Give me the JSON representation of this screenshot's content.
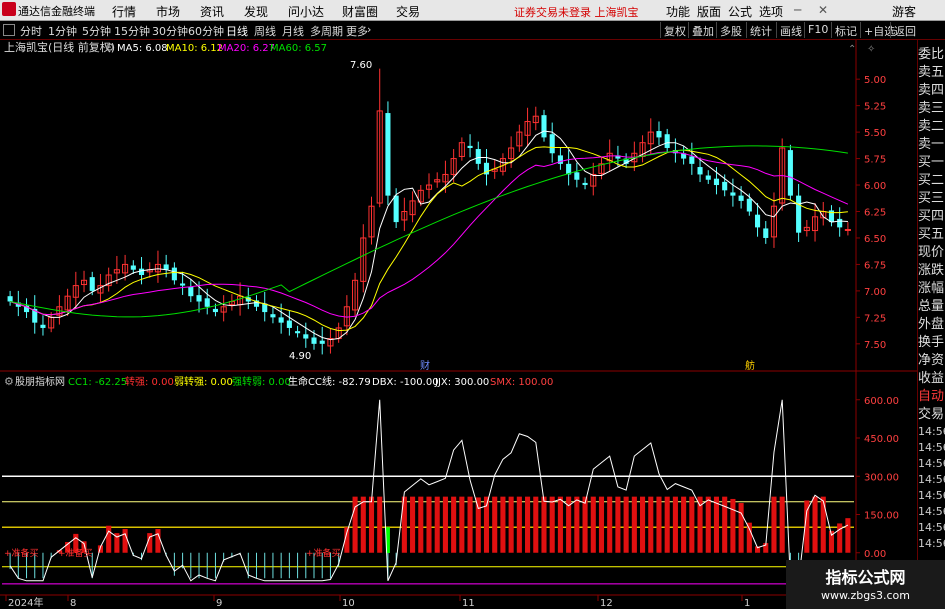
{
  "menubar": {
    "app": "通达信金融终端",
    "items": [
      "行情",
      "市场",
      "资讯",
      "发现",
      "问小达",
      "财富圈",
      "交易"
    ],
    "warning": "证券交易未登录  上海凯宝",
    "right": [
      "功能",
      "版面",
      "公式",
      "选项"
    ],
    "guest": "游客"
  },
  "toolbar": {
    "periods": [
      "分时",
      "1分钟",
      "5分钟",
      "15分钟",
      "30分钟",
      "60分钟",
      "日线",
      "周线",
      "月线",
      "多周期",
      "更多"
    ],
    "selected": "日线",
    "right": [
      "复权",
      "叠加",
      "多股",
      "统计",
      "画线",
      "F10",
      "标记",
      "+自选",
      "返回"
    ]
  },
  "main": {
    "name": "上海凯宝(日线 前复权)",
    "ma": [
      {
        "label": "MA5: 6.08",
        "color": "#ffffff"
      },
      {
        "label": "MA10: 6.12",
        "color": "#ffff00"
      },
      {
        "label": "MA20: 6.27",
        "color": "#ff00ff"
      },
      {
        "label": "MA60: 6.57",
        "color": "#00e000"
      }
    ],
    "yticks": [
      "7.50",
      "7.25",
      "7.00",
      "6.75",
      "6.50",
      "6.25",
      "6.00",
      "5.75",
      "5.50",
      "5.25",
      "5.00"
    ],
    "high_label": "7.60",
    "low_label": "4.90",
    "marker_cai": "财",
    "marker_fang": "舫"
  },
  "indicator": {
    "name": "股朋指标网",
    "fields": [
      {
        "label": "CC1: -62.25",
        "color": "#00dd00"
      },
      {
        "label": "转强: 0.00",
        "color": "#ff3030"
      },
      {
        "label": "弱转强: 0.00",
        "color": "#ffff00"
      },
      {
        "label": "强转弱: 0.00",
        "color": "#00dd00"
      },
      {
        "label": "生命CC线: -82.79",
        "color": "#ffffff"
      },
      {
        "label": "DBX: -100.00",
        "color": "#ffffff"
      },
      {
        "label": "JJX: 300.00",
        "color": "#ffffff"
      },
      {
        "label": "SMX: 100.00",
        "color": "#ff4040"
      }
    ],
    "yticks": [
      "600.00",
      "450.00",
      "300.00",
      "150.00",
      "0.00"
    ],
    "labels_left": [
      "+准备买",
      "+准备买",
      "+准备买"
    ]
  },
  "xaxis": {
    "labels": [
      "2024年",
      "8",
      "9",
      "10",
      "11",
      "12",
      "1"
    ]
  },
  "rightpanel": {
    "items": [
      "委比",
      "卖五",
      "卖四",
      "卖三",
      "卖二",
      "卖一",
      "买一",
      "买二",
      "买三",
      "买四",
      "买五",
      "现价",
      "涨跌",
      "涨幅",
      "总量",
      "外盘",
      "换手",
      "净资",
      "收益"
    ],
    "sec": [
      "自动",
      "交易"
    ],
    "times": [
      "14:56",
      "14:56",
      "14:56",
      "14:56",
      "14:56",
      "14:56",
      "14:56",
      "14:56"
    ]
  },
  "watermark": {
    "line1": "指标公式网",
    "line2": "www.zbgs3.com"
  },
  "chart_data": {
    "type": "candlestick",
    "title": "上海凯宝(日线 前复权)",
    "ylim": [
      4.8,
      7.7
    ],
    "yticks": [
      5.0,
      5.25,
      5.5,
      5.75,
      6.0,
      6.25,
      6.5,
      6.75,
      7.0,
      7.25,
      7.5
    ],
    "max_label": 7.6,
    "min_label": 4.9,
    "close": [
      5.4,
      5.35,
      5.3,
      5.2,
      5.15,
      5.25,
      5.35,
      5.45,
      5.55,
      5.6,
      5.5,
      5.55,
      5.65,
      5.7,
      5.75,
      5.7,
      5.65,
      5.7,
      5.75,
      5.7,
      5.6,
      5.55,
      5.45,
      5.4,
      5.35,
      5.3,
      5.35,
      5.4,
      5.45,
      5.4,
      5.35,
      5.3,
      5.25,
      5.2,
      5.15,
      5.1,
      5.05,
      5.0,
      5.0,
      5.05,
      5.15,
      5.35,
      5.6,
      6.0,
      6.3,
      7.2,
      6.4,
      6.15,
      6.25,
      6.35,
      6.45,
      6.5,
      6.55,
      6.6,
      6.75,
      6.9,
      6.85,
      6.7,
      6.6,
      6.65,
      6.75,
      6.85,
      7.0,
      7.1,
      7.15,
      6.95,
      6.8,
      6.7,
      6.6,
      6.55,
      6.5,
      6.6,
      6.7,
      6.8,
      6.75,
      6.7,
      6.8,
      6.9,
      7.0,
      6.95,
      6.85,
      6.8,
      6.75,
      6.7,
      6.6,
      6.55,
      6.5,
      6.45,
      6.4,
      6.35,
      6.25,
      6.1,
      6.0,
      6.3,
      6.85,
      6.4,
      6.05,
      6.1,
      6.2,
      6.25,
      6.15,
      6.1,
      6.08
    ],
    "ma60_start": 5.4,
    "ma60_end": 6.57
  },
  "indicator_data": {
    "ylim": [
      -150,
      650
    ],
    "levels": {
      "JJX": 300,
      "yellow_mid": 200,
      "SMX": 100,
      "zero": 0,
      "DBX": -100
    }
  }
}
